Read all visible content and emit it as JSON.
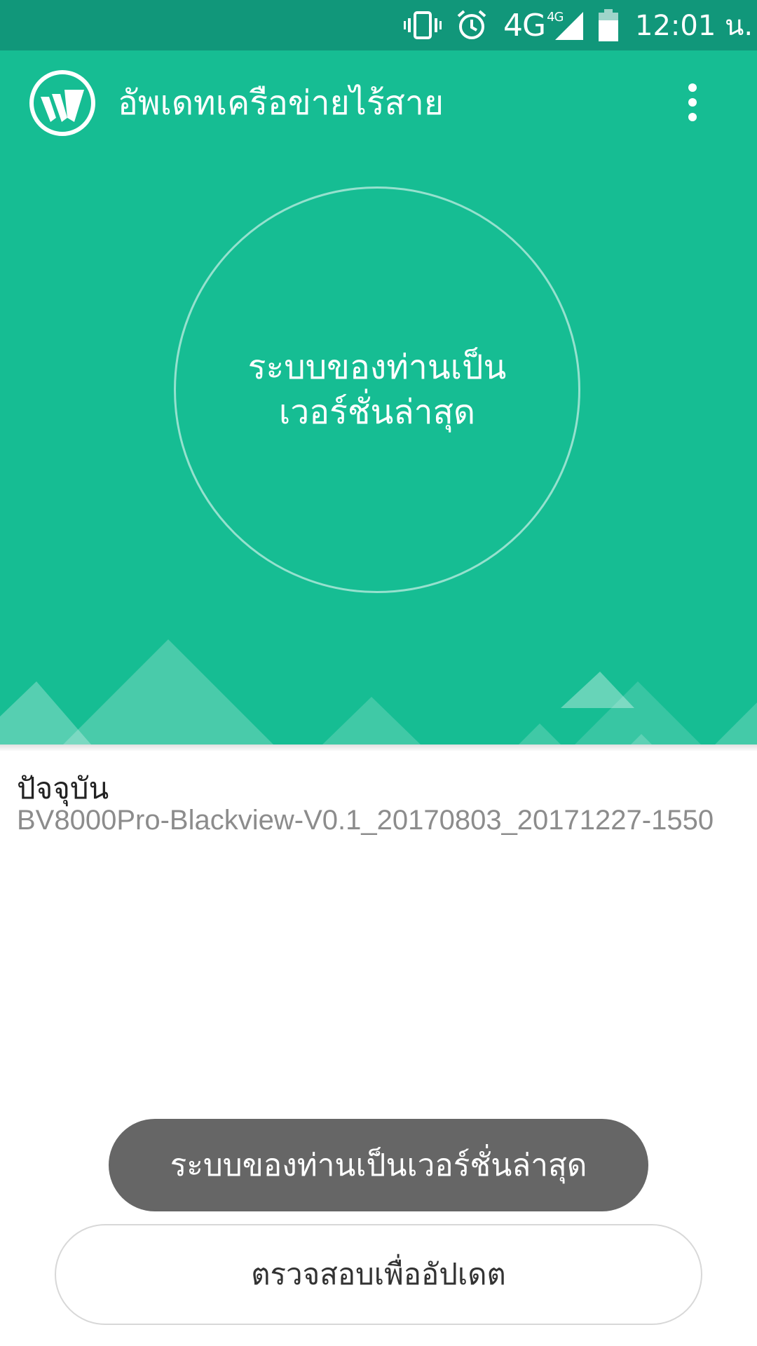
{
  "status_bar": {
    "icons": [
      "vibrate-icon",
      "alarm-icon",
      "signal-icon",
      "battery-icon"
    ],
    "network": "4G",
    "network_badge": "4G",
    "time": "12:01 น."
  },
  "app_bar": {
    "logo": "wireless-update-logo",
    "title": "อัพเดทเครือข่ายไร้สาย",
    "menu_icon": "more-vert-icon"
  },
  "hero": {
    "status_line1": "ระบบของท่านเป็น",
    "status_line2": "เวอร์ชั่นล่าสุด"
  },
  "info": {
    "current_label": "ปัจจุบัน",
    "current_version": "BV8000Pro-Blackview-V0.1_20170803_20171227-1550"
  },
  "toast": {
    "message": "ระบบของท่านเป็นเวอร์ชั่นล่าสุด"
  },
  "actions": {
    "check_label": "ตรวจสอบเพื่ออัปเดต"
  },
  "colors": {
    "status_bar": "#11977a",
    "hero_background": "#16bd93",
    "toast_background": "#666666",
    "version_text": "#8c8c8c"
  }
}
